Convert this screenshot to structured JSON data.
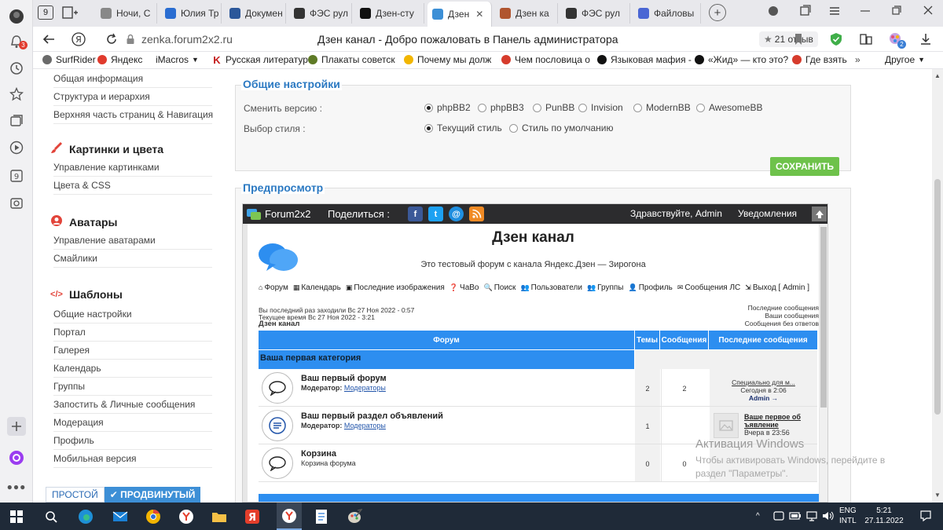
{
  "browser": {
    "tabs": [
      {
        "label": "Ночи, С",
        "favicon": "ok-icon",
        "color": "#888888"
      },
      {
        "label": "Юлия Тр",
        "favicon": "vk-icon",
        "color": "#2a6dd1"
      },
      {
        "label": "Докумен",
        "favicon": "word-icon",
        "color": "#2b579a"
      },
      {
        "label": "ФЭС рул",
        "favicon": "fr-icon",
        "color": "#333333"
      },
      {
        "label": "Дзен-сту",
        "favicon": "zen-icon",
        "color": "#111111"
      },
      {
        "label": "Дзен",
        "favicon": "chat-icon",
        "color": "#3c8fd6",
        "active": true
      },
      {
        "label": "Дзен ка",
        "favicon": "game-icon",
        "color": "#b0552f"
      },
      {
        "label": "ФЭС рул",
        "favicon": "film-icon",
        "color": "#333333"
      },
      {
        "label": "Файловы",
        "favicon": "u-icon",
        "color": "#4a66d4"
      }
    ],
    "url": "zenka.forum2x2.ru",
    "page_title": "Дзен канал - Добро пожаловать в Панель администратора",
    "reviews": "21 отзыв",
    "extension_badge": "2",
    "notification_badge": "3",
    "bookmarks": [
      {
        "label": "SurfRider",
        "color": "#6a6a6a"
      },
      {
        "label": "Яндекс",
        "color": "#e03a2d"
      },
      {
        "label": "iMacros",
        "color": "#888888"
      },
      {
        "label": "Русская литератур",
        "color": "#c41a1a",
        "glyph": "K"
      },
      {
        "label": "Плакаты советск",
        "color": "#5e7a26"
      },
      {
        "label": "Почему мы долж",
        "color": "#f2b600"
      },
      {
        "label": "Чем пословица о",
        "color": "#d63b2c"
      },
      {
        "label": "Языковая мафия -",
        "color": "#111111"
      },
      {
        "label": "«Жид» — кто это?",
        "color": "#111111"
      },
      {
        "label": "Где взять",
        "color": "#d63b2c"
      }
    ],
    "other_bookmarks": "Другое"
  },
  "admin_nav": {
    "top_items": [
      "Общая информация",
      "Структура и иерархия",
      "Верхняя часть страниц & Навигация"
    ],
    "sections": [
      {
        "title": "Картинки и цвета",
        "icon": "brush-icon",
        "color": "#e2443a",
        "items": [
          "Управление картинками",
          "Цвета & CSS"
        ]
      },
      {
        "title": "Аватары",
        "icon": "avatar-icon",
        "color": "#e2443a",
        "items": [
          "Управление аватарами",
          "Смайлики"
        ]
      },
      {
        "title": "Шаблоны",
        "icon": "code-icon",
        "color": "#e2443a",
        "items": [
          "Общие настройки",
          "Портал",
          "Галерея",
          "Календарь",
          "Группы",
          "Запостить & Личные сообщения",
          "Модерация",
          "Профиль",
          "Мобильная версия"
        ]
      }
    ],
    "mode_simple": "ПРОСТОЙ",
    "mode_advanced": "✔ ПРОДВИНУТЫЙ"
  },
  "settings": {
    "title": "Общие настройки",
    "version_label": "Сменить версию :",
    "versions": [
      "phpBB2",
      "phpBB3",
      "PunBB",
      "Invision",
      "ModernBB",
      "AwesomeBB"
    ],
    "selected_version": "phpBB2",
    "style_label": "Выбор стиля :",
    "styles": [
      "Текущий стиль",
      "Стиль по умолчанию"
    ],
    "selected_style": "Текущий стиль",
    "save": "СОХРАНИТЬ"
  },
  "preview": {
    "title": "Предпросмотр",
    "brand": "Forum2x2",
    "share": "Поделиться :",
    "greeting": "Здравствуйте, Admin",
    "notifications": "Уведомления",
    "forum_title": "Дзен канал",
    "forum_desc": "Это тестовый форум с канала Яндекс.Дзен — Зирогона",
    "nav": [
      "Форум",
      "Календарь",
      "Последние изображения",
      "ЧаВо",
      "Поиск",
      "Пользователи",
      "Группы",
      "Профиль",
      "Сообщения ЛС",
      "Выход [ Admin ]"
    ],
    "last_visit": "Вы последний раз заходили Вс 27 Ноя 2022 - 0:57",
    "current_time": "Текущее время Вс 27 Ноя 2022 - 3:21",
    "crumb": "Дзен канал",
    "right_links": [
      "Последние сообщения",
      "Ваши сообщения",
      "Сообщения без ответов"
    ],
    "table_headers": [
      "Форум",
      "Темы",
      "Сообщения",
      "Последние сообщения"
    ],
    "category": "Ваша первая категория",
    "forums": [
      {
        "name": "Ваш первый форум",
        "moderator_label": "Модератор:",
        "moderator": "Модераторы",
        "topics": "2",
        "posts": "2",
        "last_post": "Специально для м...",
        "last_time": "Сегодня в 2:06",
        "last_user": "Admin →"
      },
      {
        "name": "Ваш первый раздел объявлений",
        "moderator_label": "Модератор:",
        "moderator": "Модераторы",
        "topics": "1",
        "posts": "",
        "last_post": "Ваше первое об ъявление",
        "last_time": "Вчера в 23:56",
        "last_user": ""
      },
      {
        "name": "Корзина",
        "moderator_label": "",
        "moderator": "Корзина форума",
        "topics": "0",
        "posts": "0",
        "last_post": "",
        "last_time": "",
        "last_user": ""
      }
    ]
  },
  "watermark": {
    "line1": "Активация Windows",
    "line2": "Чтобы активировать Windows, перейдите в",
    "line3": "раздел \"Параметры\"."
  },
  "taskbar": {
    "lang": "ENG",
    "layout": "INTL",
    "time": "5:21",
    "date": "27.11.2022"
  }
}
